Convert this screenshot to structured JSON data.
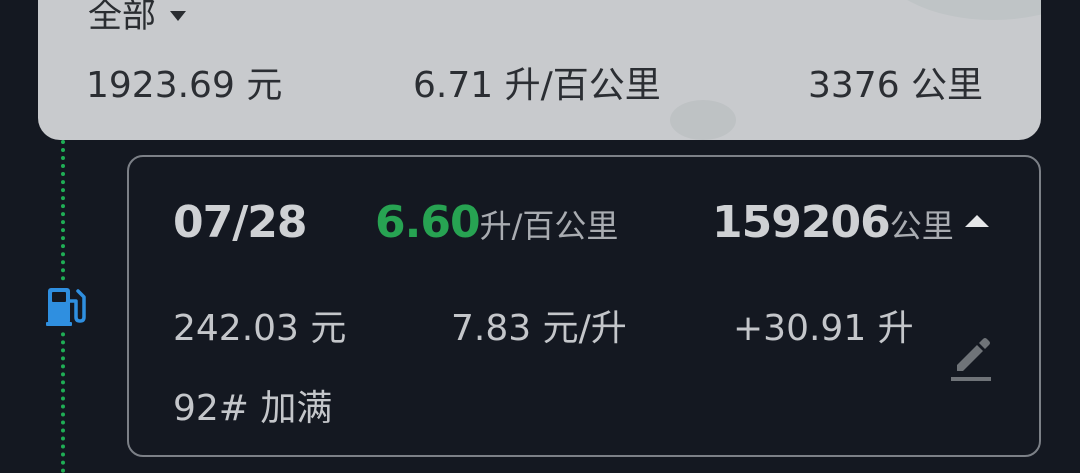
{
  "summary": {
    "filter_label": "全部",
    "total_cost": "1923.69 元",
    "avg_consumption": "6.71 升/百公里",
    "total_distance": "3376 公里"
  },
  "record": {
    "date": "07/28",
    "consumption_value": "6.60",
    "consumption_unit": "升/百公里",
    "odometer_value": "159206",
    "odometer_unit": "公里",
    "cost": "242.03 元",
    "unit_price": "7.83 元/升",
    "volume": "+30.91 升",
    "fuel_type": "92# 加满"
  },
  "colors": {
    "background": "#141821",
    "summary_card": "#c8cacd",
    "efficiency_green": "#27a352",
    "timeline_green": "#1fae55",
    "fuel_icon_blue": "#2f8fe0"
  },
  "icons": {
    "filter": "chevron-down-icon",
    "station": "fuel-pump-icon",
    "collapse": "chevron-up-icon",
    "edit": "pencil-icon"
  }
}
